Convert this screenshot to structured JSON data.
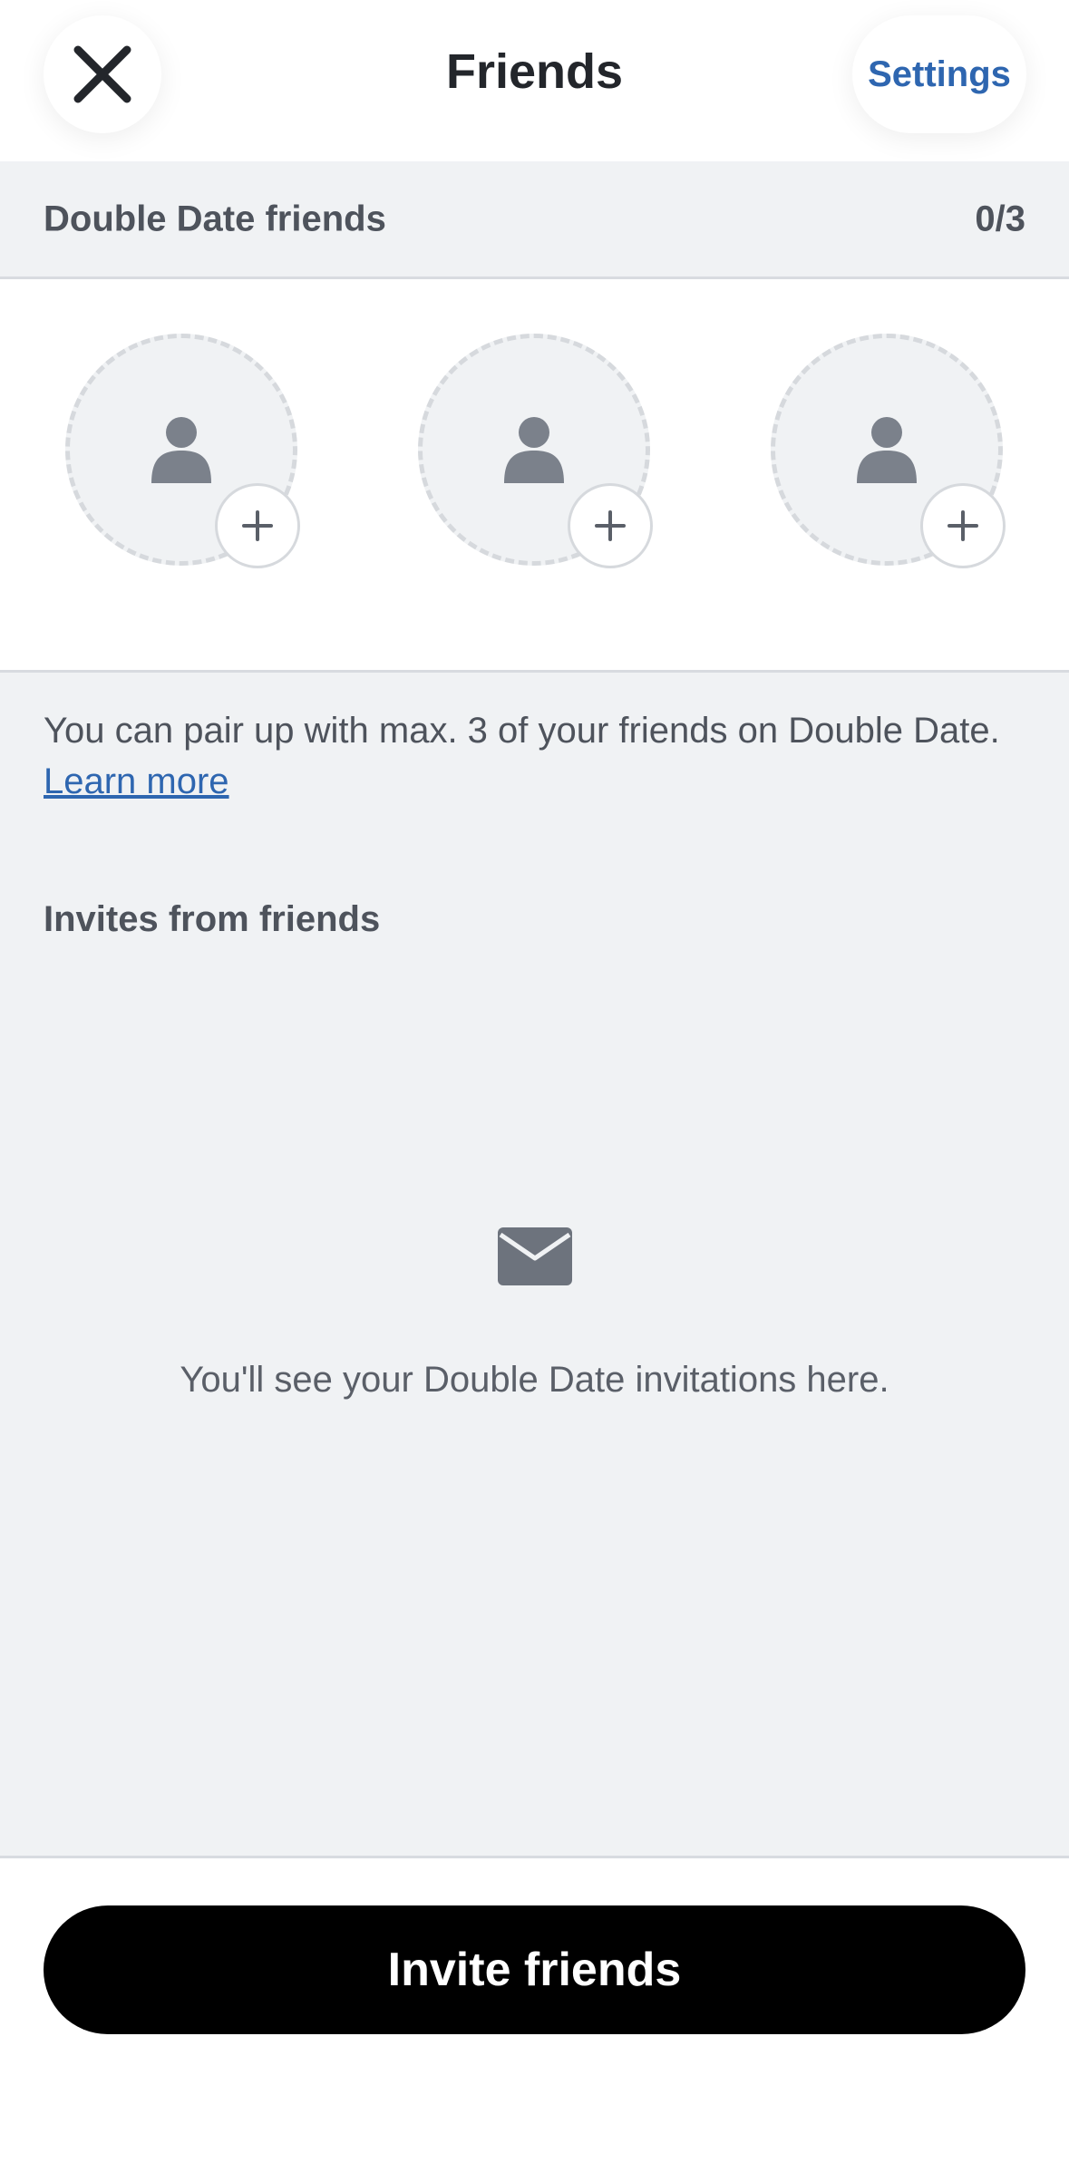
{
  "header": {
    "title": "Friends",
    "settings_label": "Settings",
    "close_icon": "close-icon"
  },
  "double_date": {
    "section_title": "Double Date friends",
    "count": "0/3",
    "slots": [
      {
        "icon": "person-icon",
        "add_icon": "plus-icon"
      },
      {
        "icon": "person-icon",
        "add_icon": "plus-icon"
      },
      {
        "icon": "person-icon",
        "add_icon": "plus-icon"
      }
    ]
  },
  "info": {
    "text": "You can pair up with max. 3 of your friends on Double Date.",
    "link": "Learn more"
  },
  "invites": {
    "section_title": "Invites from friends",
    "empty_icon": "mail-icon",
    "empty_text": "You'll see your Double Date invitations here."
  },
  "footer": {
    "invite_label": "Invite friends"
  },
  "colors": {
    "accent": "#2e66b0",
    "background_gray": "#f0f2f4",
    "button": "#000000"
  }
}
